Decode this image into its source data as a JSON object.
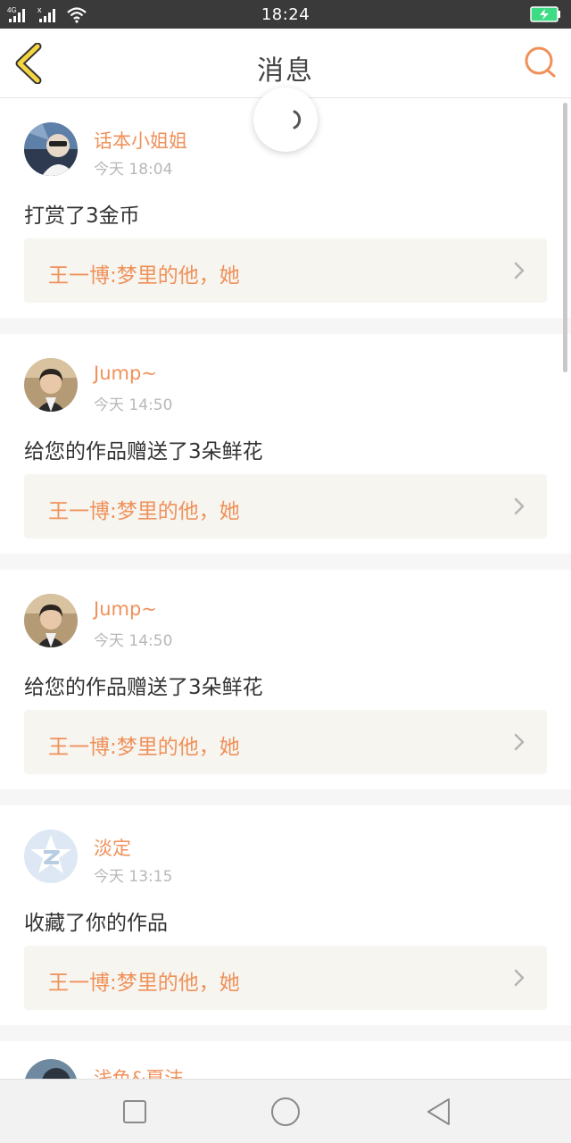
{
  "status_bar": {
    "time": "18:24",
    "network_label": "4G",
    "icons": [
      "signal-icon",
      "no-signal-icon",
      "wifi-icon",
      "battery-charging-icon"
    ]
  },
  "header": {
    "title": "消息",
    "back_icon": "chevron-left-icon",
    "search_icon": "search-icon"
  },
  "messages": [
    {
      "user": "话本小姐姐",
      "time": "今天 18:04",
      "action": "打赏了3金币",
      "work": "王一博:梦里的他，她",
      "avatar": "photo-avatar"
    },
    {
      "user": "Jump~",
      "time": "今天 14:50",
      "action": "给您的作品赠送了3朵鲜花",
      "work": "王一博:梦里的他，她",
      "avatar": "photo-avatar"
    },
    {
      "user": "Jump~",
      "time": "今天 14:50",
      "action": "给您的作品赠送了3朵鲜花",
      "work": "王一博:梦里的他，她",
      "avatar": "photo-avatar"
    },
    {
      "user": "淡定",
      "time": "今天 13:15",
      "action": "收藏了你的作品",
      "work": "王一博:梦里的他，她",
      "avatar": "qq-star-avatar"
    }
  ],
  "partial_item": {
    "user": "浅色&夏沫"
  },
  "nav_bar": {
    "icons": [
      "recent-apps-icon",
      "home-icon",
      "back-icon"
    ]
  },
  "colors": {
    "accent": "#f0915a",
    "back_icon": "#f5d640",
    "status_bar": "#3a3a3a",
    "battery": "#3ddc84"
  }
}
